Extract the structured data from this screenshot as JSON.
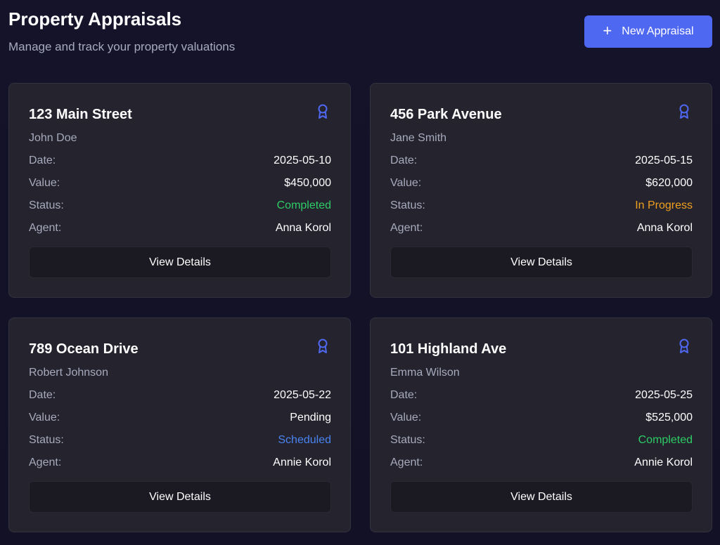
{
  "header": {
    "title": "Property Appraisals",
    "subtitle": "Manage and track your property valuations",
    "new_button_icon": "plus-icon",
    "new_button_label": "New Appraisal"
  },
  "labels": {
    "date": "Date:",
    "value": "Value:",
    "status": "Status:",
    "agent": "Agent:",
    "view_details": "View Details"
  },
  "card_icon": "award-ribbon-icon",
  "colors": {
    "accent": "#4f68f2",
    "completed": "#2ecc66",
    "in_progress": "#f0a020",
    "scheduled": "#4a84f0"
  },
  "cards": [
    {
      "address": "123 Main Street",
      "client": "John Doe",
      "date": "2025-05-10",
      "value": "$450,000",
      "status": "Completed",
      "agent": "Anna Korol"
    },
    {
      "address": "456 Park Avenue",
      "client": "Jane Smith",
      "date": "2025-05-15",
      "value": "$620,000",
      "status": "In Progress",
      "agent": "Anna Korol"
    },
    {
      "address": "789 Ocean Drive",
      "client": "Robert Johnson",
      "date": "2025-05-22",
      "value": "Pending",
      "status": "Scheduled",
      "agent": "Annie Korol"
    },
    {
      "address": "101 Highland Ave",
      "client": "Emma Wilson",
      "date": "2025-05-25",
      "value": "$525,000",
      "status": "Completed",
      "agent": "Annie Korol"
    }
  ]
}
